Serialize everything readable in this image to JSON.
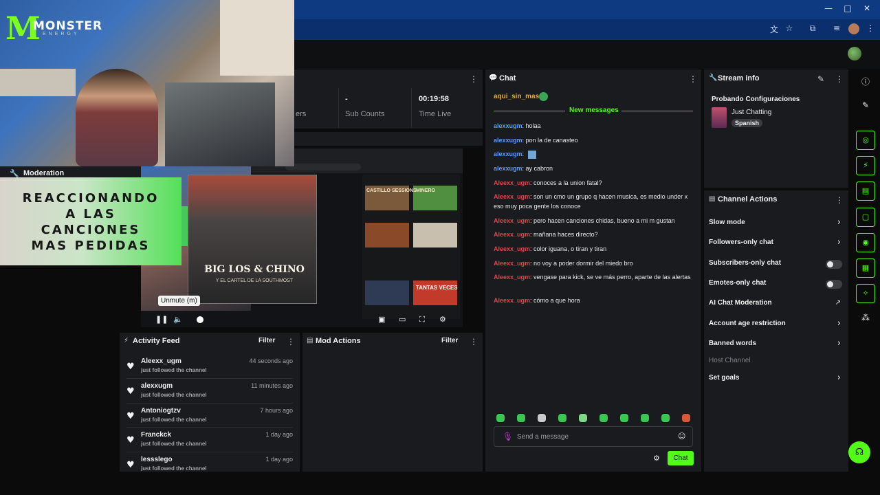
{
  "browser": {
    "window_controls": [
      "—",
      "□",
      "✕"
    ],
    "toolbar_icons": [
      "translate-icon",
      "star-icon",
      "extensions-icon",
      "reading-list-icon",
      "profile-avatar",
      "menu-icon"
    ]
  },
  "stats": {
    "items": [
      {
        "value": "",
        "label": "ers"
      },
      {
        "value": "-",
        "label": "Sub Counts"
      },
      {
        "value": "00:19:58",
        "label": "Time Live"
      }
    ]
  },
  "overlay": {
    "brand": "MONSTER",
    "brand_sub": "ENERGY",
    "banner_lines": [
      "REACCIONANDO",
      "A LAS",
      "CANCIONES",
      "MAS PEDIDAS"
    ],
    "moderation_title": "Moderation"
  },
  "video": {
    "album_title": "BIG LOS & CHINO",
    "album_subtitle": "Y EL CARTEL DE LA SOUTHMOST",
    "tooltip": "Unmute (m)",
    "thumb_labels": [
      "CASTILLO SESSIONS",
      "MINERO",
      "TANTAS VECES"
    ]
  },
  "activity_feed": {
    "title": "Activity Feed",
    "filter_label": "Filter",
    "items": [
      {
        "user": "Aleexx_ugm",
        "time": "44 seconds ago",
        "action": "just followed the channel"
      },
      {
        "user": "alexxugm",
        "time": "11 minutes ago",
        "action": "just followed the channel"
      },
      {
        "user": "Antoniogtzv",
        "time": "7 hours ago",
        "action": "just followed the channel"
      },
      {
        "user": "Franckck",
        "time": "1 day ago",
        "action": "just followed the channel"
      },
      {
        "user": "lessslego",
        "time": "1 day ago",
        "action": "just followed the channel"
      }
    ]
  },
  "mod_actions": {
    "title": "Mod Actions",
    "filter_label": "Filter"
  },
  "chat": {
    "title": "Chat",
    "pinned": {
      "user": "aqui_sin_mas:",
      "color": "#e0a84a"
    },
    "new_messages_label": "New messages",
    "messages": [
      {
        "user": "alexxugm",
        "text": ": holaa",
        "color": "#5b9bff"
      },
      {
        "user": "alexxugm",
        "text": ": pon la de canasteo",
        "color": "#5b9bff"
      },
      {
        "user": "alexxugm",
        "text": ":",
        "color": "#5b9bff"
      },
      {
        "user": "alexxugm",
        "text": ": ay cabron",
        "color": "#5b9bff"
      },
      {
        "user": "Aleexx_ugm",
        "text": ": conoces a la union fatal?",
        "color": "#e0444a"
      },
      {
        "user": "Aleexx_ugm",
        "text": ": son un cmo un grupo q hacen musica, es medio under x eso muy poca gente los conoce",
        "color": "#e0444a"
      },
      {
        "user": "Aleexx_ugm",
        "text": ": pero hacen canciones chidas, bueno a mi m gustan",
        "color": "#e0444a"
      },
      {
        "user": "Aleexx_ugm",
        "text": ": mañana haces directo?",
        "color": "#e0444a"
      },
      {
        "user": "Aleexx_ugm",
        "text": ": color iguana, o tiran y tiran",
        "color": "#e0444a"
      },
      {
        "user": "Aleexx_ugm",
        "text": ": no voy a poder dormir del miedo bro",
        "color": "#e0444a"
      },
      {
        "user": "Aleexx_ugm",
        "text": ": vengase para kick, se ve más perro, aparte de las alertas",
        "color": "#e0444a"
      },
      {
        "user": "Aleexx_ugm",
        "text": ": cómo a que hora",
        "color": "#e0444a"
      }
    ],
    "input_placeholder": "Send a message",
    "send_label": "Chat"
  },
  "stream_info": {
    "title": "Stream info",
    "stream_title": "Probando Configuraciones",
    "category": "Just Chatting",
    "language_tag": "Spanish"
  },
  "channel_actions": {
    "title": "Channel Actions",
    "items": [
      {
        "label": "Slow mode",
        "control": "chevron"
      },
      {
        "label": "Followers-only chat",
        "control": "chevron"
      },
      {
        "label": "Subscribers-only chat",
        "control": "toggle"
      },
      {
        "label": "Emotes-only chat",
        "control": "toggle"
      },
      {
        "label": "AI Chat Moderation",
        "control": "external"
      },
      {
        "label": "Account age restriction",
        "control": "chevron"
      },
      {
        "label": "Banned words",
        "control": "chevron"
      },
      {
        "label": "Host Channel",
        "control": "none"
      },
      {
        "label": "Set goals",
        "control": "chevron"
      }
    ]
  },
  "sidebar": {
    "icons": [
      "info-icon",
      "pencil-icon",
      "capture-icon",
      "lightning-icon",
      "notes-icon",
      "chat-bubble-icon",
      "broadcast-icon",
      "layout-icon",
      "wrench-icon",
      "nodes-icon"
    ]
  },
  "colors": {
    "accent": "#53fc18",
    "panel": "#1a1b1e",
    "background": "#0b0b0c"
  }
}
